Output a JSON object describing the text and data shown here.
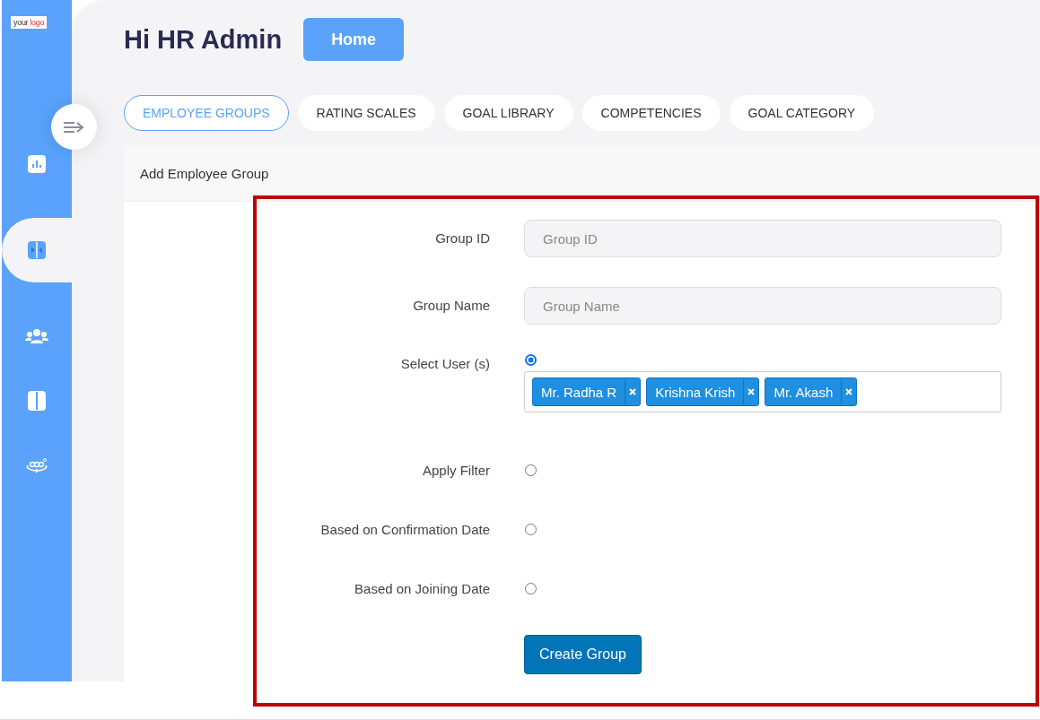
{
  "logo": [
    "your",
    "logo"
  ],
  "sidebar": {
    "items": [
      {
        "kind": "chart",
        "selected": false
      },
      {
        "kind": "split",
        "selected": true
      },
      {
        "kind": "people",
        "selected": false
      },
      {
        "kind": "book",
        "selected": false
      },
      {
        "kind": "rotate",
        "selected": false
      }
    ]
  },
  "greeting": "Hi HR Admin",
  "home_button": "Home",
  "tabs": [
    {
      "label": "EMPLOYEE GROUPS",
      "selected": true
    },
    {
      "label": "RATING SCALES",
      "selected": false
    },
    {
      "label": "GOAL LIBRARY",
      "selected": false
    },
    {
      "label": "COMPETENCIES",
      "selected": false
    },
    {
      "label": "GOAL CATEGORY",
      "selected": false
    }
  ],
  "card_title": "Add Employee Group",
  "form": [
    {
      "kind": "text",
      "label": "Group ID",
      "placeholder": "Group ID"
    },
    {
      "kind": "text",
      "label": "Group Name",
      "placeholder": "Group Name"
    },
    {
      "kind": "users",
      "label": "Select User (s)",
      "selected": true,
      "tags": [
        "Mr. Radha R",
        "Krishna Krish",
        "Mr. Akash"
      ]
    },
    {
      "kind": "option",
      "label": "Apply Filter",
      "selected": false
    },
    {
      "kind": "option",
      "label": "Based on Confirmation Date",
      "selected": false
    },
    {
      "kind": "option",
      "label": "Based on Joining Date",
      "selected": false
    }
  ],
  "submit_button": "Create Group"
}
